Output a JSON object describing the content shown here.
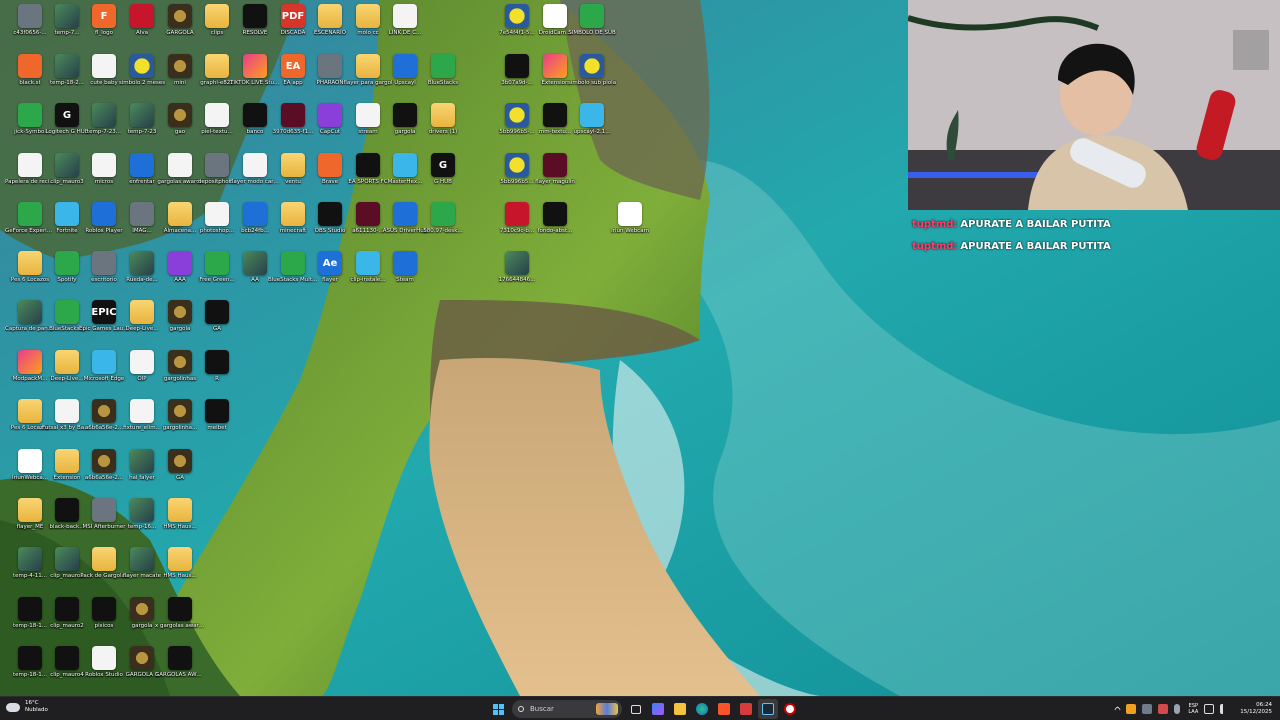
{
  "desktop": {
    "icons": [
      {
        "label": "c43f0656-...",
        "glyph": "g-gray",
        "ch": ""
      },
      {
        "label": "temp-7...",
        "glyph": "g-img",
        "ch": ""
      },
      {
        "label": "fl_logo",
        "glyph": "g-orange",
        "ch": "F"
      },
      {
        "label": "Alva",
        "glyph": "g-red",
        "ch": ""
      },
      {
        "label": "GARGOLA",
        "glyph": "g-gold",
        "ch": ""
      },
      {
        "label": "clips",
        "glyph": "g-folder",
        "ch": ""
      },
      {
        "label": "RESOLVE",
        "glyph": "g-black",
        "ch": ""
      },
      {
        "label": "DISCADA",
        "glyph": "g-pdf",
        "ch": "PDF"
      },
      {
        "label": "ESCENARIO",
        "glyph": "g-folder",
        "ch": ""
      },
      {
        "label": "molo cc",
        "glyph": "g-folder",
        "ch": ""
      },
      {
        "label": "LINK DE C...",
        "glyph": "g-file",
        "ch": ""
      },
      {
        "label": "7e54f4f1-5...",
        "glyph": "g-yellow",
        "ch": ""
      },
      {
        "label": "DroidCam...",
        "glyph": "g-ring",
        "ch": ""
      },
      {
        "label": "SIMBOLO DE SUB",
        "glyph": "g-green",
        "ch": ""
      },
      {
        "label": "black.st",
        "glyph": "g-orange",
        "ch": ""
      },
      {
        "label": "temp-18-2...",
        "glyph": "g-img",
        "ch": ""
      },
      {
        "label": "cute baby",
        "glyph": "g-file",
        "ch": ""
      },
      {
        "label": "simbolo 2 meses",
        "glyph": "g-yellow",
        "ch": ""
      },
      {
        "label": "mini",
        "glyph": "g-gold",
        "ch": ""
      },
      {
        "label": "graphi-e822",
        "glyph": "g-folder",
        "ch": ""
      },
      {
        "label": "TIKTOK LIVE Studio",
        "glyph": "g-pink",
        "ch": ""
      },
      {
        "label": "EA app",
        "glyph": "g-orange",
        "ch": "EA"
      },
      {
        "label": "PHARAON",
        "glyph": "g-gray",
        "ch": ""
      },
      {
        "label": "flayer para gargol",
        "glyph": "g-folder",
        "ch": ""
      },
      {
        "label": "Upscayl",
        "glyph": "g-blue",
        "ch": ""
      },
      {
        "label": "BlueStacks",
        "glyph": "g-green",
        "ch": ""
      },
      {
        "label": "3b07a9d-...",
        "glyph": "g-black",
        "ch": ""
      },
      {
        "label": "Extension",
        "glyph": "g-pink",
        "ch": ""
      },
      {
        "label": "simbolo sub piola",
        "glyph": "g-yellow",
        "ch": ""
      },
      {
        "label": "jick-Symbol",
        "glyph": "g-green",
        "ch": ""
      },
      {
        "label": "Logitech G HUB",
        "glyph": "g-black",
        "ch": "G"
      },
      {
        "label": "temp-7-23...",
        "glyph": "g-img",
        "ch": ""
      },
      {
        "label": "temp-7-23",
        "glyph": "g-img",
        "ch": ""
      },
      {
        "label": "gao",
        "glyph": "g-gold",
        "ch": ""
      },
      {
        "label": "piel-textu...",
        "glyph": "g-file",
        "ch": ""
      },
      {
        "label": "banco",
        "glyph": "g-black",
        "ch": ""
      },
      {
        "label": "3970d635-f1...",
        "glyph": "g-darkred",
        "ch": ""
      },
      {
        "label": "CapCut",
        "glyph": "g-purple",
        "ch": ""
      },
      {
        "label": "stream",
        "glyph": "g-file",
        "ch": ""
      },
      {
        "label": "gargola",
        "glyph": "g-black",
        "ch": ""
      },
      {
        "label": "drivers (1)",
        "glyph": "g-folder",
        "ch": ""
      },
      {
        "label": "5bb996b5-...",
        "glyph": "g-yellow",
        "ch": ""
      },
      {
        "label": "mm-textu...",
        "glyph": "g-black",
        "ch": ""
      },
      {
        "label": "upscayl-2.1...",
        "glyph": "g-cyan",
        "ch": ""
      },
      {
        "label": "Papelera de reciclaje",
        "glyph": "g-file",
        "ch": ""
      },
      {
        "label": "clip_mauro3",
        "glyph": "g-img",
        "ch": ""
      },
      {
        "label": "micros",
        "glyph": "g-file",
        "ch": ""
      },
      {
        "label": "enfrentar",
        "glyph": "g-blue",
        "ch": ""
      },
      {
        "label": "gargolas awards",
        "glyph": "g-file",
        "ch": ""
      },
      {
        "label": "depositphot...",
        "glyph": "g-gray",
        "ch": ""
      },
      {
        "label": "flayer modo carrera",
        "glyph": "g-file",
        "ch": ""
      },
      {
        "label": "ventu",
        "glyph": "g-folder",
        "ch": ""
      },
      {
        "label": "Brave",
        "glyph": "g-orange",
        "ch": ""
      },
      {
        "label": "EA SPORTS FC",
        "glyph": "g-black",
        "ch": ""
      },
      {
        "label": "MasterHex...",
        "glyph": "g-cyan",
        "ch": ""
      },
      {
        "label": "G HUB",
        "glyph": "g-black",
        "ch": "G"
      },
      {
        "label": "5bb996b5...",
        "glyph": "g-yellow",
        "ch": ""
      },
      {
        "label": "flayer magulin",
        "glyph": "g-darkred",
        "ch": ""
      },
      {
        "label": "GeForce Experience",
        "glyph": "g-green",
        "ch": ""
      },
      {
        "label": "Fortnite",
        "glyph": "g-cyan",
        "ch": ""
      },
      {
        "label": "Roblox Player",
        "glyph": "g-blue",
        "ch": ""
      },
      {
        "label": "IMAG...",
        "glyph": "g-gray",
        "ch": ""
      },
      {
        "label": "Almacena...",
        "glyph": "g-folder",
        "ch": ""
      },
      {
        "label": "photoshop...",
        "glyph": "g-file",
        "ch": ""
      },
      {
        "label": "bcb24fb...",
        "glyph": "g-blue",
        "ch": ""
      },
      {
        "label": "minecraft",
        "glyph": "g-folder",
        "ch": ""
      },
      {
        "label": "OBS Studio",
        "glyph": "g-black",
        "ch": ""
      },
      {
        "label": "a611130-...",
        "glyph": "g-darkred",
        "ch": ""
      },
      {
        "label": "ASUS DriverHub",
        "glyph": "g-blue",
        "ch": ""
      },
      {
        "label": "580.97-desk...",
        "glyph": "g-green",
        "ch": ""
      },
      {
        "label": "7310c9c-b...",
        "glyph": "g-red",
        "ch": ""
      },
      {
        "label": "fondo-abst...",
        "glyph": "g-black",
        "ch": ""
      },
      {
        "label": "Iriun Webcam",
        "glyph": "g-ring",
        "ch": ""
      },
      {
        "label": "Pes 6 Locazos",
        "glyph": "g-folder",
        "ch": ""
      },
      {
        "label": "Spotify",
        "glyph": "g-green",
        "ch": ""
      },
      {
        "label": "escritorio",
        "glyph": "g-gray",
        "ch": ""
      },
      {
        "label": "Rueda-de...",
        "glyph": "g-img",
        "ch": ""
      },
      {
        "label": "AAA",
        "glyph": "g-purple",
        "ch": ""
      },
      {
        "label": "Free Green...",
        "glyph": "g-green",
        "ch": ""
      },
      {
        "label": "AA",
        "glyph": "g-img",
        "ch": ""
      },
      {
        "label": "BlueStacks Multi-Insta...",
        "glyph": "g-green",
        "ch": ""
      },
      {
        "label": "flayer",
        "glyph": "g-blue",
        "ch": "Ae"
      },
      {
        "label": "clip-instale...",
        "glyph": "g-cyan",
        "ch": ""
      },
      {
        "label": "Steam",
        "glyph": "g-blue",
        "ch": ""
      },
      {
        "label": "176644846...",
        "glyph": "g-img",
        "ch": ""
      },
      {
        "label": "Captura de pantalla",
        "glyph": "g-img",
        "ch": ""
      },
      {
        "label": "BlueStacks X",
        "glyph": "g-green",
        "ch": ""
      },
      {
        "label": "Epic Games Launcher",
        "glyph": "g-black",
        "ch": "EPIC"
      },
      {
        "label": "Deep-Live...",
        "glyph": "g-folder",
        "ch": ""
      },
      {
        "label": "gargola",
        "glyph": "g-gold",
        "ch": ""
      },
      {
        "label": "GA",
        "glyph": "g-black",
        "ch": ""
      },
      {
        "label": "ModpackM...",
        "glyph": "g-pink",
        "ch": ""
      },
      {
        "label": "Deep-Live...",
        "glyph": "g-folder",
        "ch": ""
      },
      {
        "label": "Microsoft Edge",
        "glyph": "g-cyan",
        "ch": ""
      },
      {
        "label": "OIP",
        "glyph": "g-file",
        "ch": ""
      },
      {
        "label": "gargolinhas",
        "glyph": "g-gold",
        "ch": ""
      },
      {
        "label": "R",
        "glyph": "g-black",
        "ch": ""
      },
      {
        "label": "Pes 6 Locazos",
        "glyph": "g-folder",
        "ch": ""
      },
      {
        "label": "Futsal x3 by Bazinga Fro...",
        "glyph": "g-file",
        "ch": ""
      },
      {
        "label": "a6b6a56e-2...",
        "glyph": "g-gold",
        "ch": ""
      },
      {
        "label": "fixture_elim...",
        "glyph": "g-file",
        "ch": ""
      },
      {
        "label": "gargolinha...",
        "glyph": "g-gold",
        "ch": ""
      },
      {
        "label": "melbet",
        "glyph": "g-black",
        "ch": ""
      },
      {
        "label": "IriunWebca...",
        "glyph": "g-ring",
        "ch": ""
      },
      {
        "label": "Extension",
        "glyph": "g-folder",
        "ch": ""
      },
      {
        "label": "a6b6a56e-2...",
        "glyph": "g-gold",
        "ch": ""
      },
      {
        "label": "hai falyer",
        "glyph": "g-img",
        "ch": ""
      },
      {
        "label": "GA",
        "glyph": "g-gold",
        "ch": ""
      },
      {
        "label": "flayer_ME",
        "glyph": "g-folder",
        "ch": ""
      },
      {
        "label": "black-back...",
        "glyph": "g-black",
        "ch": ""
      },
      {
        "label": "MSI Afterburner",
        "glyph": "g-gray",
        "ch": ""
      },
      {
        "label": "temp-16...",
        "glyph": "g-img",
        "ch": ""
      },
      {
        "label": "HMS Haus...",
        "glyph": "g-folder",
        "ch": ""
      },
      {
        "label": "temp-4-11...",
        "glyph": "g-img",
        "ch": ""
      },
      {
        "label": "clip_mauro3",
        "glyph": "g-img",
        "ch": ""
      },
      {
        "label": "Pack de Gargolas",
        "glyph": "g-folder",
        "ch": ""
      },
      {
        "label": "flayer macate",
        "glyph": "g-img",
        "ch": ""
      },
      {
        "label": "HMS Haus...",
        "glyph": "g-folder",
        "ch": ""
      },
      {
        "label": "temp-18-1...",
        "glyph": "g-black",
        "ch": ""
      },
      {
        "label": "clip_mauro2",
        "glyph": "g-black",
        "ch": ""
      },
      {
        "label": "pisicos",
        "glyph": "g-black",
        "ch": ""
      },
      {
        "label": "gargola",
        "glyph": "g-gold",
        "ch": ""
      },
      {
        "label": "x gargolas awards",
        "glyph": "g-black",
        "ch": ""
      },
      {
        "label": "temp-18-1...",
        "glyph": "g-black",
        "ch": ""
      },
      {
        "label": "clip_mauro4",
        "glyph": "g-black",
        "ch": ""
      },
      {
        "label": "Roblox Studio",
        "glyph": "g-file",
        "ch": ""
      },
      {
        "label": "GARGOLA 3",
        "glyph": "g-gold",
        "ch": ""
      },
      {
        "label": "GARGOLAS AWARDS",
        "glyph": "g-black",
        "ch": ""
      }
    ]
  },
  "chat": {
    "messages": [
      {
        "user": "tuptmd:",
        "text": "APURATE A BAILAR PUTITA"
      },
      {
        "user": "tuptmd:",
        "text": "APURATE A BAILAR PUTITA"
      }
    ]
  },
  "taskbar": {
    "weather": {
      "temp": "16°C",
      "condition": "Nublado"
    },
    "search_placeholder": "Buscar",
    "apps": [
      "start-icon",
      "search",
      "task-view-icon",
      "widgets-icon",
      "file-explorer-icon",
      "edge-icon",
      "brave-icon",
      "calendar-icon",
      "steam-icon",
      "obs-icon"
    ],
    "lang_top": "ESP",
    "lang_bottom": "LAA",
    "time": "06:24",
    "date": "15/12/2025"
  },
  "colors": {
    "chat_user": "#ff3b6a",
    "taskbar_bg": "#1f1f21"
  }
}
